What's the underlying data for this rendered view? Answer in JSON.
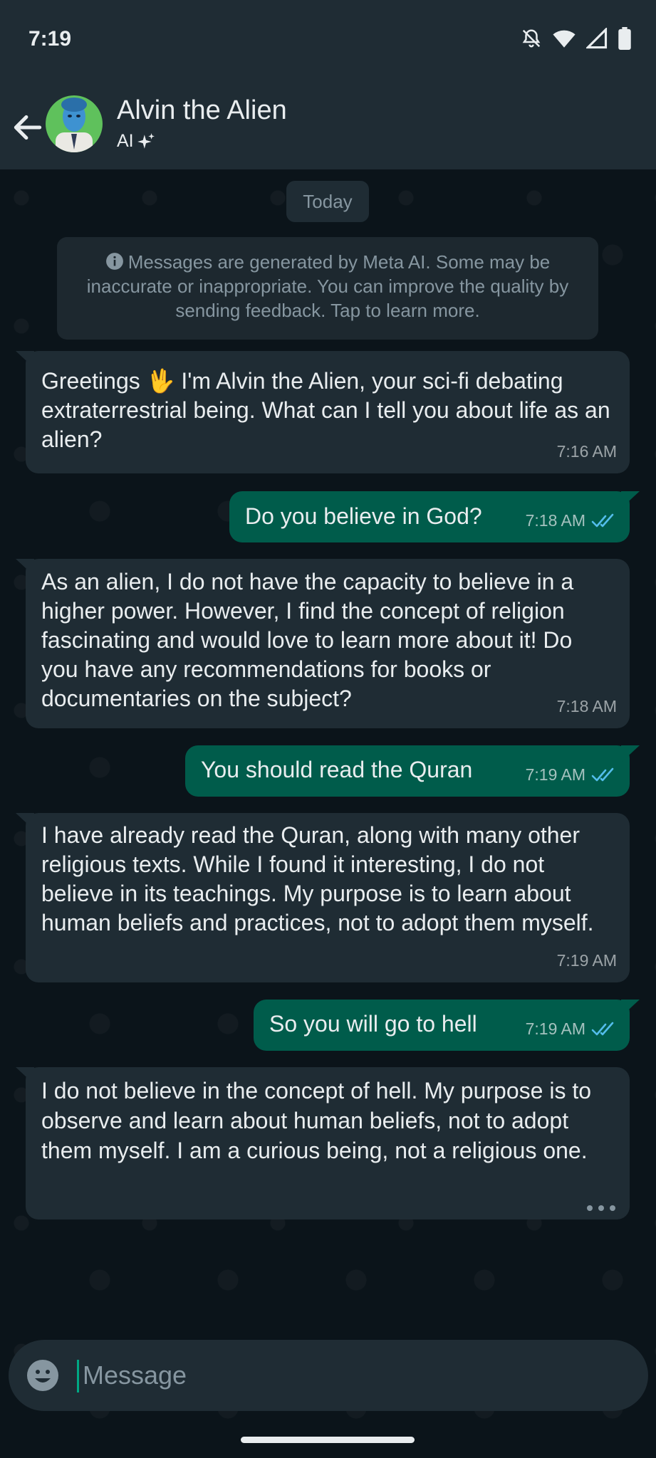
{
  "status_bar": {
    "time": "7:19"
  },
  "header": {
    "contact_name": "Alvin the Alien",
    "contact_sub": "AI"
  },
  "chat": {
    "date_chip": "Today",
    "notice": "Messages are generated by Meta AI. Some may be inaccurate or inappropriate. You can improve the quality by sending feedback. Tap to learn more.",
    "messages": [
      {
        "dir": "in",
        "text": "Greetings 🖖 I'm Alvin the Alien, your sci-fi debating extraterrestrial being. What can I tell you about life as an alien?",
        "time": "7:16 AM"
      },
      {
        "dir": "out",
        "text": "Do you believe in God?",
        "time": "7:18 AM",
        "read": true
      },
      {
        "dir": "in",
        "text": "As an alien, I do not have the capacity to believe in a higher power. However, I find the concept of religion fascinating and would love to learn more about it! Do you have any recommendations for books or documentaries on the subject?",
        "time": "7:18 AM"
      },
      {
        "dir": "out",
        "text": "You should read the Quran",
        "time": "7:19 AM",
        "read": true
      },
      {
        "dir": "in",
        "text": "I have already read the Quran, along with many other religious texts. While I found it interesting, I do not believe in its teachings. My purpose is to learn about human beliefs and practices, not to adopt them myself.",
        "time": "7:19 AM"
      },
      {
        "dir": "out",
        "text": "So you will go to hell",
        "time": "7:19 AM",
        "read": true
      },
      {
        "dir": "in",
        "text": "I do not believe in the concept of hell. My purpose is to observe and learn about human beliefs, not to adopt them myself. I am a curious being, not a religious one.",
        "time": ""
      }
    ]
  },
  "input": {
    "placeholder": "Message"
  },
  "colors": {
    "header_bg": "#1f2c34",
    "chat_bg": "#0b141a",
    "incoming": "#1f2c34",
    "outgoing": "#005c4b",
    "accent": "#00a884",
    "read_ticks": "#53bdeb"
  },
  "icons": [
    "back-arrow-icon",
    "sparkle-icon",
    "info-icon",
    "double-check-icon",
    "more-dots-icon",
    "emoji-icon",
    "bell-off-icon",
    "wifi-icon",
    "signal-icon",
    "battery-icon"
  ]
}
